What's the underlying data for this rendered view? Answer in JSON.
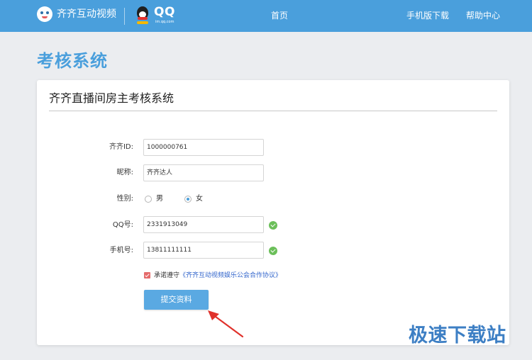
{
  "header": {
    "brand_name": "齐齐互动视频",
    "qq_text": "QQ",
    "qq_url": "im.qq.com",
    "nav": [
      {
        "label": "首页"
      },
      {
        "label": "手机版下载"
      },
      {
        "label": "帮助中心"
      }
    ]
  },
  "page_title": "考核系统",
  "form": {
    "title": "齐齐直播间房主考核系统",
    "id_label": "齐齐ID:",
    "id_value": "1000000761",
    "nickname_label": "昵称:",
    "nickname_value": "齐齐达人",
    "gender_label": "性别:",
    "gender_options": [
      {
        "label": "男",
        "checked": false
      },
      {
        "label": "女",
        "checked": true
      }
    ],
    "qq_label": "QQ号:",
    "qq_value": "2331913049",
    "phone_label": "手机号:",
    "phone_value": "13811111111",
    "agree_prefix": "承诺遵守",
    "agree_link": "《齐齐互动视频娱乐公会合作协议》",
    "agree_checked": true,
    "submit_label": "提交资料"
  },
  "watermark": "极速下载站",
  "colors": {
    "header_bg": "#4a9fdc",
    "title_blue": "#4a9fdc",
    "button_bg": "#5aa9e2",
    "check_green": "#6bbf59",
    "arrow_red": "#e0312b",
    "link_blue": "#3366cc"
  }
}
